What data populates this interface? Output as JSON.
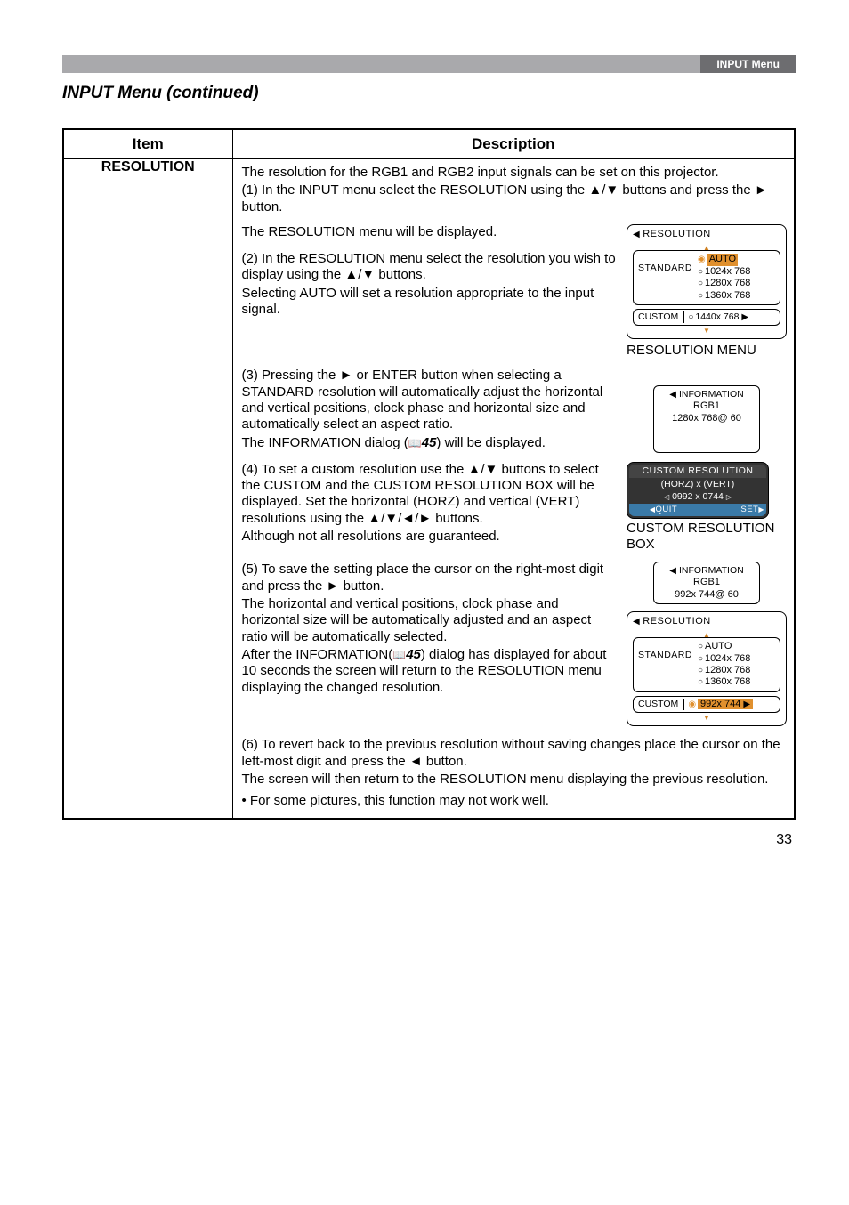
{
  "header": {
    "tab": "INPUT Menu"
  },
  "title": "INPUT Menu (continued)",
  "table": {
    "head": {
      "item": "Item",
      "desc": "Description"
    },
    "row": {
      "item": "RESOLUTION",
      "intro": "The resolution for the RGB1 and RGB2 input signals can be set on this projector.",
      "step1a": "(1) In the INPUT menu select the RESOLUTION using the ▲/▼ buttons and press the ► button.",
      "step1b": "The RESOLUTION menu will be displayed.",
      "step2a": "(2)  In the RESOLUTION menu select the resolution you wish to display using the ▲/▼ buttons.",
      "step2b": "Selecting AUTO will set a resolution appropriate to the input signal.",
      "step3a": "(3) Pressing the ► or ENTER button when selecting a STANDARD resolution will automatically adjust the horizontal and vertical positions, clock phase and horizontal size and automatically select an aspect ratio.",
      "step3b_pre": "The INFORMATION dialog (",
      "step3b_ref": "45",
      "step3b_post": ")  will be displayed.",
      "step4a": "(4) To set a custom resolution use the ▲/▼ buttons to select the CUSTOM and the CUSTOM RESOLUTION BOX will be displayed. Set the horizontal (HORZ) and vertical (VERT) resolutions using the ▲/▼/◄/► buttons.",
      "step4b": "Although not all resolutions are guaranteed.",
      "step5a": "(5) To save the setting place the cursor on the right-most digit and press the ► button.",
      "step5b": "The horizontal and vertical positions, clock phase and horizontal size will be automatically adjusted and an aspect ratio will be automatically selected.",
      "step5c_pre": "After the INFORMATION(",
      "step5c_ref": "45",
      "step5c_post": ") dialog has displayed for about 10 seconds the screen will return to the RESOLUTION menu displaying the changed resolution.",
      "step6a": "(6) To revert back to the previous resolution without saving changes place the cursor on the left-most digit and press the ◄ button.",
      "step6b": "The screen will then return to the RESOLUTION menu displaying the previous resolution.",
      "bullet": "• For some pictures, this function may not work well."
    }
  },
  "figures": {
    "resMenu1": {
      "title": "RESOLUTION",
      "auto": "AUTO",
      "standard": "STANDARD",
      "r1": "1024x  768",
      "r2": "1280x  768",
      "r3": "1360x  768",
      "custom": "CUSTOM",
      "customRes": "1440x  768",
      "caption": "RESOLUTION MENU"
    },
    "info1": {
      "hdr": "INFORMATION",
      "line1": "RGB1",
      "line2": "1280x 768@ 60"
    },
    "customBox": {
      "hdr": "CUSTOM RESOLUTION",
      "line1": "(HORZ) x (VERT)",
      "line2": "0992 x 0744",
      "quit": "QUIT",
      "set": "SET",
      "caption": "CUSTOM RESOLUTION BOX"
    },
    "info2": {
      "hdr": "INFORMATION",
      "line1": "RGB1",
      "line2": "992x 744@ 60"
    },
    "resMenu2": {
      "title": "RESOLUTION",
      "auto": "AUTO",
      "standard": "STANDARD",
      "r1": "1024x  768",
      "r2": "1280x  768",
      "r3": "1360x  768",
      "custom": "CUSTOM",
      "customRes": "992x  744"
    }
  },
  "pageNumber": "33"
}
